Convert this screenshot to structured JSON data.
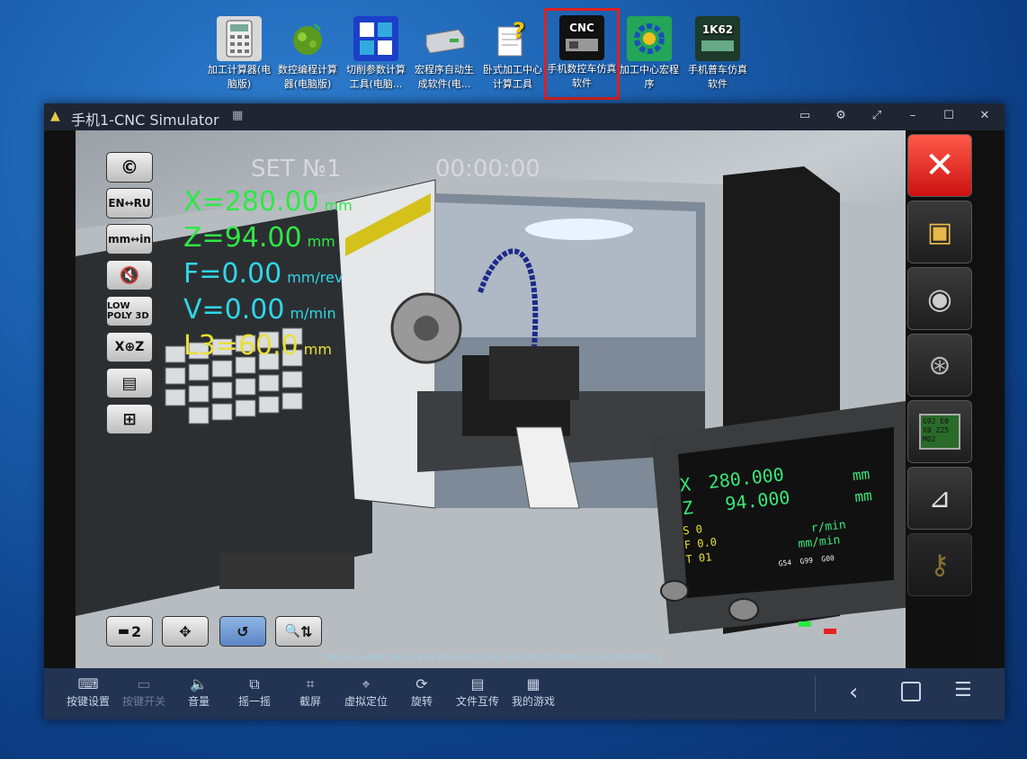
{
  "desktop_icons": [
    {
      "label": "加工计算器(电脑版)",
      "icon": "calculator-icon"
    },
    {
      "label": "数控编程计算器(电脑版)",
      "icon": "green-blob-icon"
    },
    {
      "label": "切削参数计算工具(电脑...",
      "icon": "cube-tool-icon"
    },
    {
      "label": "宏程序自动生成软件(电...",
      "icon": "drive-icon"
    },
    {
      "label": "卧式加工中心计算工具",
      "icon": "question-doc-icon"
    },
    {
      "label": "手机数控车仿真软件",
      "icon": "cnc-icon",
      "icon_text": "CNC"
    },
    {
      "label": "加工中心宏程序",
      "icon": "gear-macro-icon"
    },
    {
      "label": "手机普车仿真软件",
      "icon": "lathe-1k62-icon",
      "icon_text": "1K62"
    }
  ],
  "window": {
    "title": "手机1-CNC Simulator",
    "controls": [
      "message-icon",
      "settings-icon",
      "expand-icon",
      "minimize-icon",
      "maximize-icon",
      "close-icon"
    ]
  },
  "sim": {
    "set_no": "SET №1",
    "timer": "00:00:00",
    "x": {
      "value": "X=280.00",
      "unit": "mm"
    },
    "z": {
      "value": "Z=94.00",
      "unit": "mm"
    },
    "f": {
      "value": "F=0.00",
      "unit": "mm/rev"
    },
    "v": {
      "value": "V=0.00",
      "unit": "m/min"
    },
    "l": {
      "value": "L3=60.0",
      "unit": "mm"
    },
    "left_buttons": [
      "©",
      "EN↔RU",
      "mm↔in",
      "🔇",
      "LOW POLY 3D",
      "X⊕Z",
      "▤",
      "⊞"
    ],
    "bottom_buttons": [
      "2",
      "✥",
      "↺",
      "⇅"
    ],
    "stats": "FPS: 60.2; VRAM [MB]: 179.88; POLY: 45237; IMG: 365; SPT: 871; TIME [S]: 0.001379; PNTS: 4",
    "panel": {
      "x_label": "X",
      "x_value": "280.000",
      "z_label": "Z",
      "z_value": "94.000",
      "unit_top": "mm",
      "unit_bottom": "mm",
      "s": "S 0",
      "f": "F 0.0",
      "t": "T 01",
      "rate_top": "r/min",
      "rate_bottom": "mm/min",
      "codes": [
        "G54",
        "G99",
        "G00"
      ]
    },
    "right_buttons": [
      "close-red-icon",
      "save-icon",
      "chuck-icon",
      "tool-icon",
      "program-icon",
      "caliper-icon",
      "key-icon"
    ],
    "program_text": "G92 E0 X0 Z25 M02"
  },
  "bottom_bar": {
    "items": [
      {
        "label": "按键设置",
        "icon": "keyboard-icon"
      },
      {
        "label": "按键开关",
        "icon": "toggle-icon"
      },
      {
        "label": "音量",
        "icon": "speaker-icon"
      },
      {
        "label": "摇一摇",
        "icon": "shake-icon"
      },
      {
        "label": "截屏",
        "icon": "screenshot-icon"
      },
      {
        "label": "虚拟定位",
        "icon": "location-icon"
      },
      {
        "label": "旋转",
        "icon": "rotate-icon"
      },
      {
        "label": "文件互传",
        "icon": "file-transfer-icon"
      },
      {
        "label": "我的游戏",
        "icon": "games-icon"
      }
    ],
    "nav": [
      "back-icon",
      "home-icon",
      "menu-icon"
    ]
  }
}
